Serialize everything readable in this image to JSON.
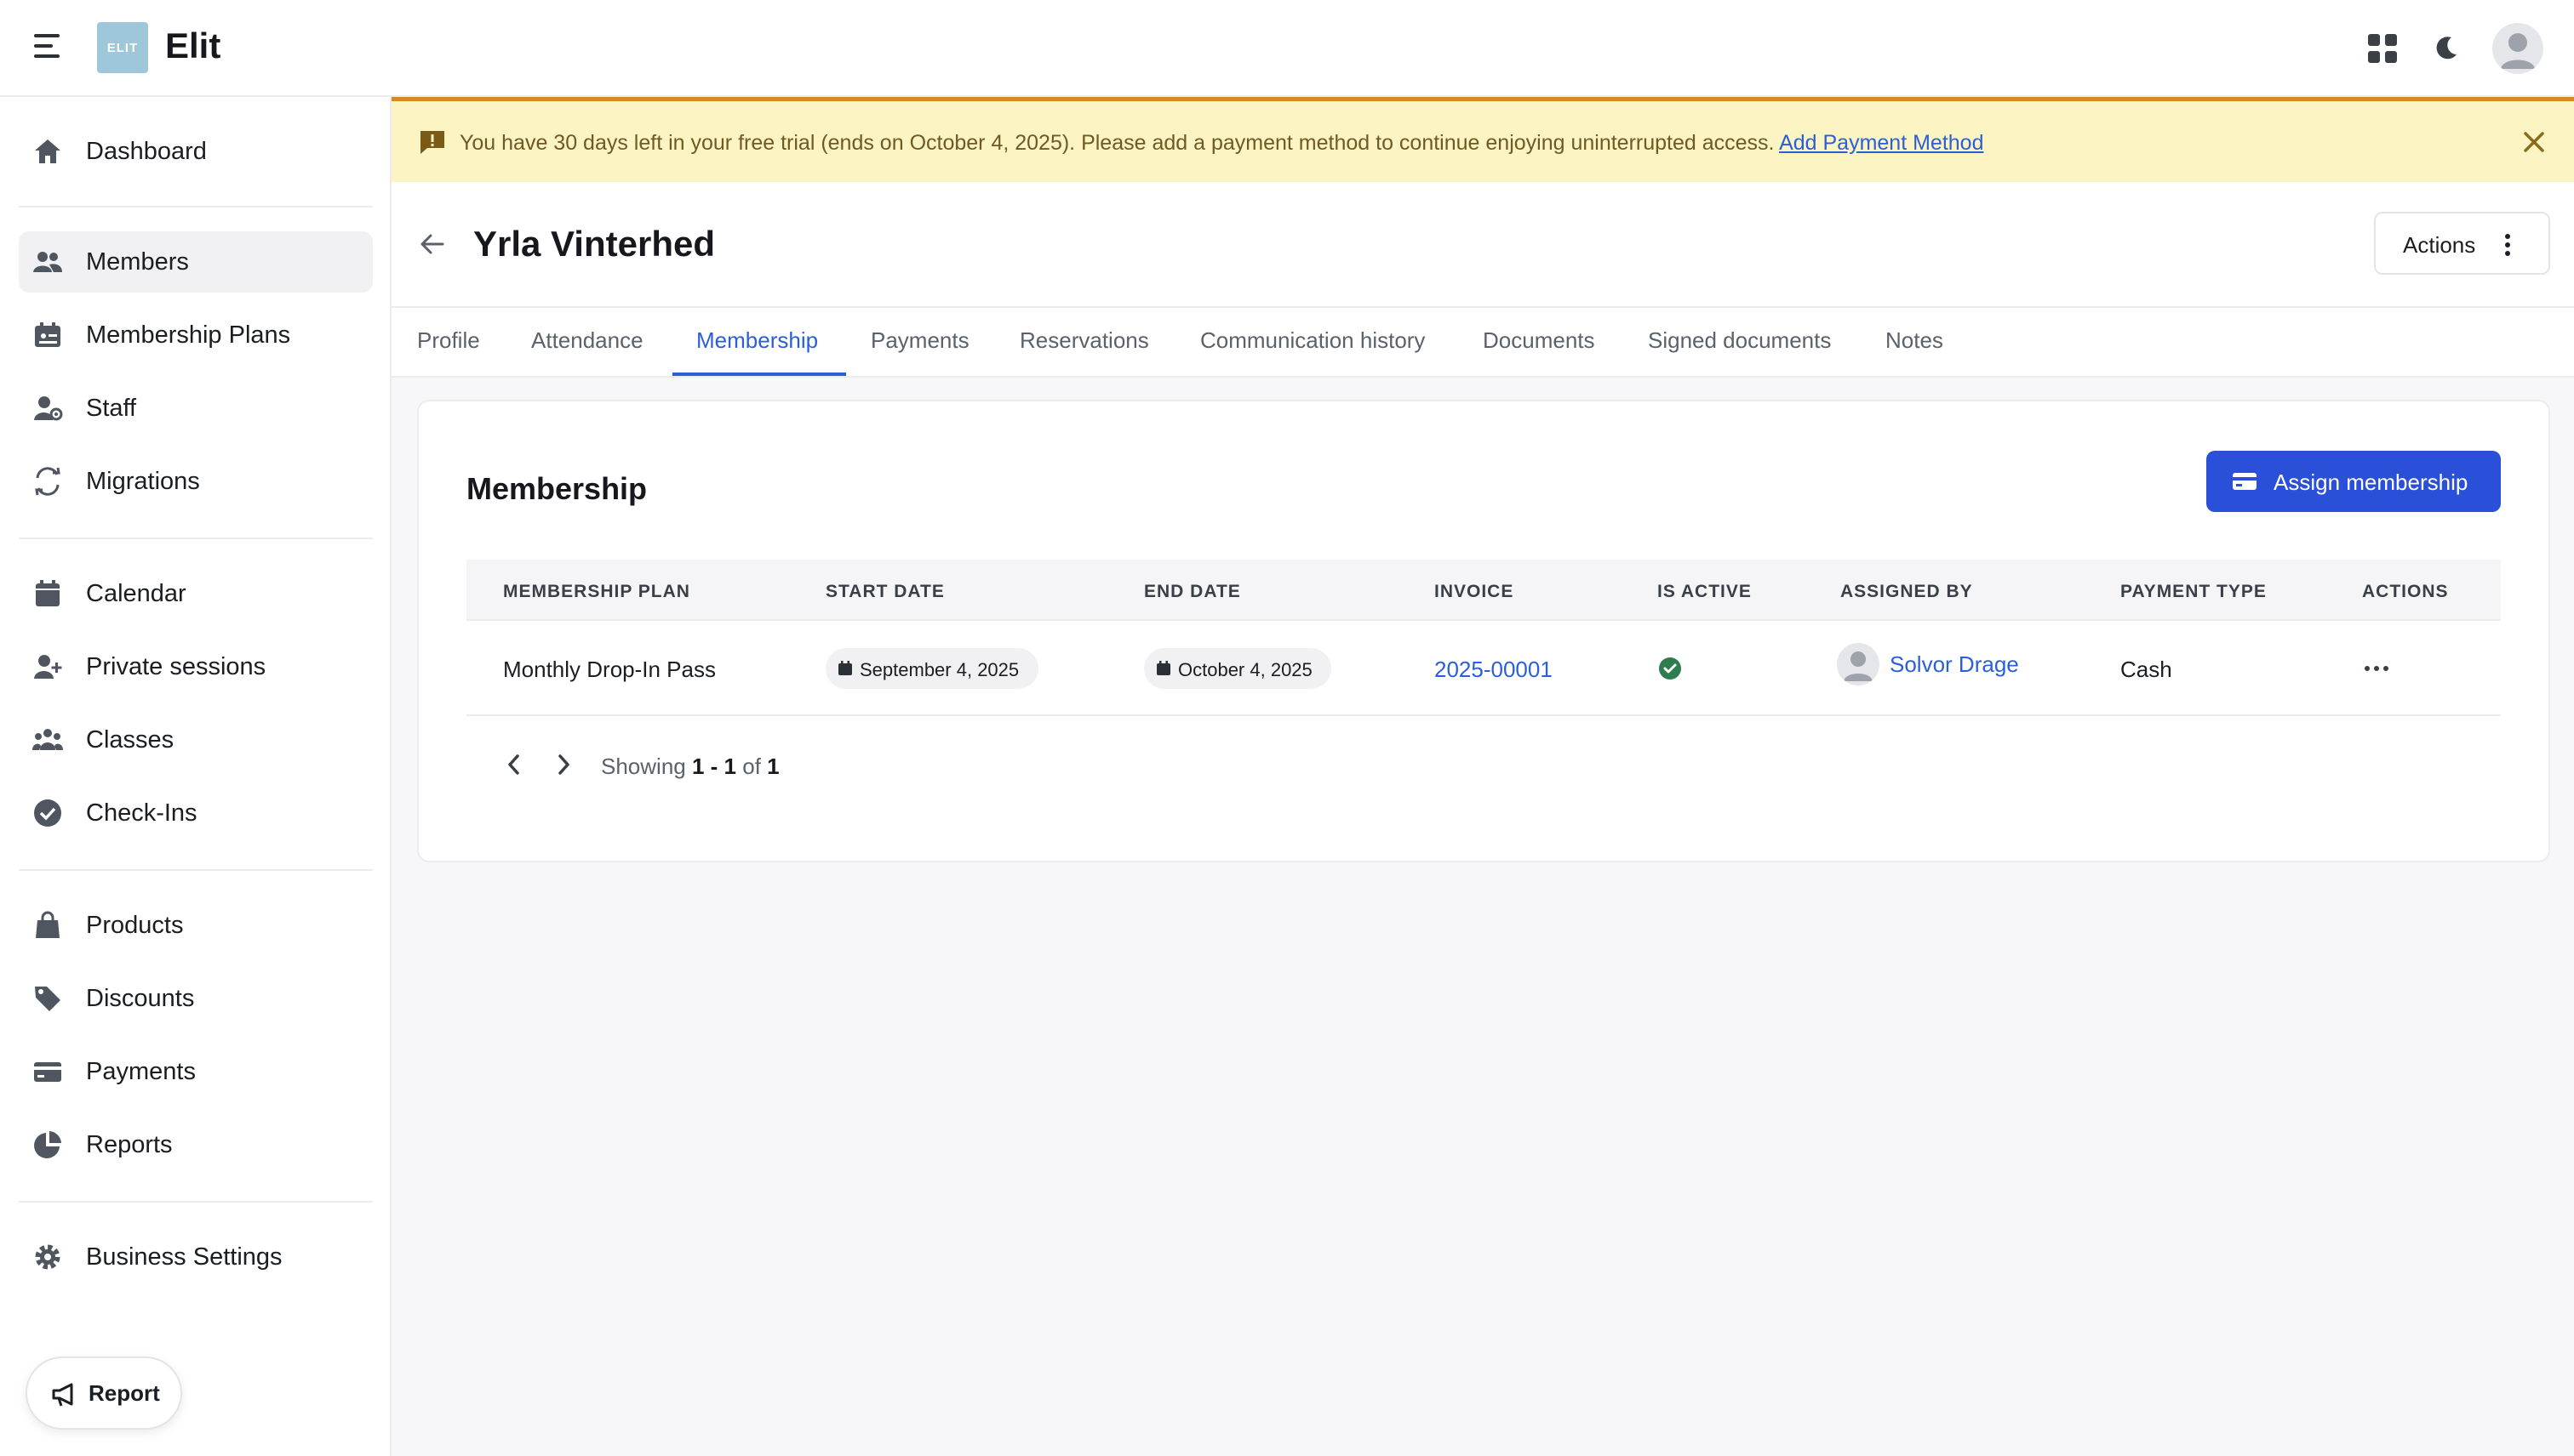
{
  "app": {
    "name": "Elit",
    "logo_text": "ELIT"
  },
  "sidebar": {
    "items": [
      {
        "label": "Dashboard",
        "icon": "home-icon"
      },
      {
        "label": "Members",
        "icon": "users-icon",
        "active": true
      },
      {
        "label": "Membership Plans",
        "icon": "membership-plans-icon"
      },
      {
        "label": "Staff",
        "icon": "staff-icon"
      },
      {
        "label": "Migrations",
        "icon": "migrations-icon"
      },
      {
        "label": "Calendar",
        "icon": "calendar-icon"
      },
      {
        "label": "Private sessions",
        "icon": "private-sessions-icon"
      },
      {
        "label": "Classes",
        "icon": "classes-icon"
      },
      {
        "label": "Check-Ins",
        "icon": "check-circle-icon"
      },
      {
        "label": "Products",
        "icon": "shopping-bag-icon"
      },
      {
        "label": "Discounts",
        "icon": "tag-icon"
      },
      {
        "label": "Payments",
        "icon": "credit-card-icon"
      },
      {
        "label": "Reports",
        "icon": "pie-chart-icon"
      },
      {
        "label": "Business Settings",
        "icon": "gear-icon"
      }
    ],
    "report_button": "Report"
  },
  "banner": {
    "text": "You have 30 days left in your free trial (ends on October 4, 2025). Please add a payment method to continue enjoying uninterrupted access.",
    "link": "Add Payment Method"
  },
  "header": {
    "title": "Yrla Vinterhed",
    "actions_label": "Actions"
  },
  "tabs": [
    {
      "label": "Profile"
    },
    {
      "label": "Attendance"
    },
    {
      "label": "Membership",
      "active": true
    },
    {
      "label": "Payments"
    },
    {
      "label": "Reservations"
    },
    {
      "label": "Communication history"
    },
    {
      "label": "Documents"
    },
    {
      "label": "Signed documents"
    },
    {
      "label": "Notes"
    }
  ],
  "membership": {
    "title": "Membership",
    "assign_label": "Assign membership",
    "columns": [
      "MEMBERSHIP PLAN",
      "START DATE",
      "END DATE",
      "INVOICE",
      "IS ACTIVE",
      "ASSIGNED BY",
      "PAYMENT TYPE",
      "ACTIONS"
    ],
    "rows": [
      {
        "plan": "Monthly Drop-In Pass",
        "start_date": "September 4, 2025",
        "end_date": "October 4, 2025",
        "invoice": "2025-00001",
        "is_active": true,
        "assigned_by": "Solvor Drage",
        "payment_type": "Cash"
      }
    ],
    "pagination": {
      "prefix": "Showing",
      "range": "1 - 1",
      "of": "of",
      "total": "1"
    }
  },
  "colors": {
    "accent": "#2a4fd8",
    "link": "#2b5fd9",
    "banner_bg": "#fcf4c3",
    "banner_border": "#d48a1f",
    "success": "#2e7d4f"
  }
}
